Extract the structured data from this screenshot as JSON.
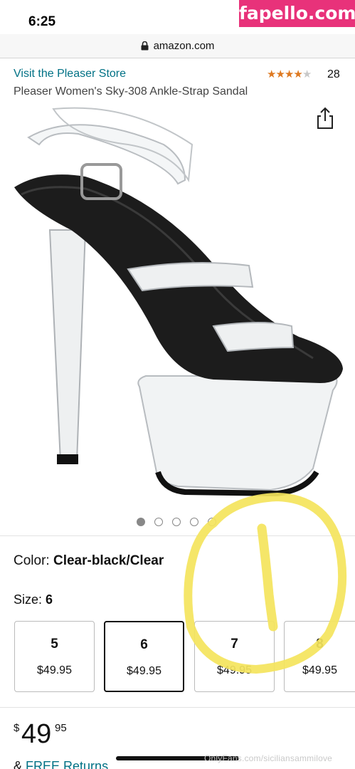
{
  "status_bar": {
    "time": "6:25"
  },
  "watermark": {
    "text": "fapello.com",
    "color": "#e8327a"
  },
  "browser": {
    "url": "amazon.com"
  },
  "product": {
    "store_link": "Visit the Pleaser Store",
    "rating": 4,
    "rating_max": 5,
    "rating_count": "28",
    "title": "Pleaser Women's Sky-308 Ankle-Strap Sandal",
    "image_count": 5,
    "active_image_index": 0
  },
  "color": {
    "label": "Color:",
    "value": "Clear-black/Clear"
  },
  "size": {
    "label": "Size:",
    "value": "6",
    "options": [
      {
        "size": "5",
        "price": "$49.95",
        "selected": false
      },
      {
        "size": "6",
        "price": "$49.95",
        "selected": true
      },
      {
        "size": "7",
        "price": "$49.95",
        "selected": false
      },
      {
        "size": "8",
        "price": "$49.95",
        "selected": false
      }
    ]
  },
  "price": {
    "symbol": "$",
    "whole": "49",
    "fraction": "95"
  },
  "returns": {
    "prefix": "&",
    "link": "FREE Returns"
  },
  "footer": {
    "watermark": "OnlyFans.com/siciliansammilove"
  },
  "colors": {
    "link": "#007185",
    "star": "#de7921",
    "annotation": "#f4e45c"
  }
}
